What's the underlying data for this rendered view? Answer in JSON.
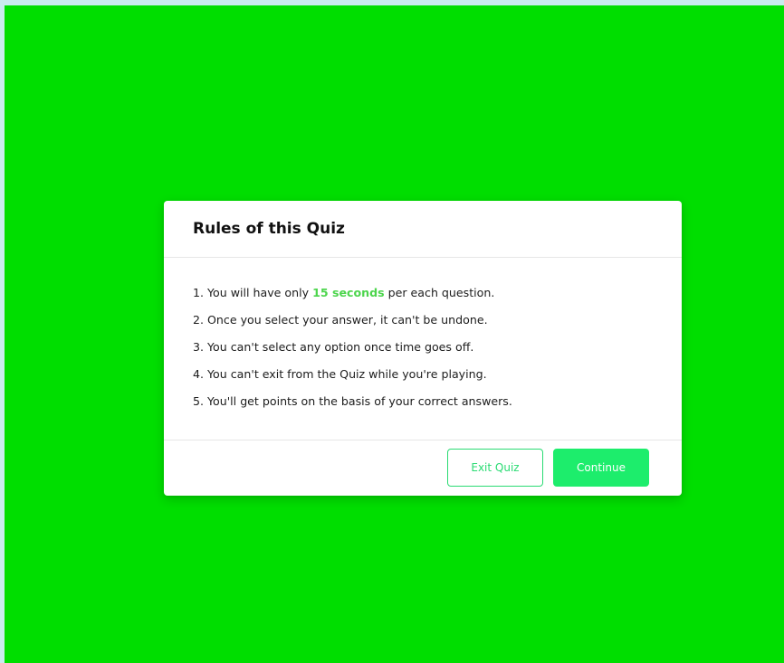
{
  "colors": {
    "page_background": "#00de00",
    "outer_background": "#c9ebee",
    "highlight": "#4dd54d",
    "accent": "#1ded6c"
  },
  "modal": {
    "title": "Rules of this Quiz",
    "rules": [
      {
        "prefix": "1. You will have only ",
        "highlight": "15 seconds",
        "suffix": " per each question."
      },
      {
        "text": "2. Once you select your answer, it can't be undone."
      },
      {
        "text": "3. You can't select any option once time goes off."
      },
      {
        "text": "4. You can't exit from the Quiz while you're playing."
      },
      {
        "text": "5. You'll get points on the basis of your correct answers."
      }
    ],
    "buttons": {
      "exit_label": "Exit Quiz",
      "continue_label": "Continue"
    }
  }
}
